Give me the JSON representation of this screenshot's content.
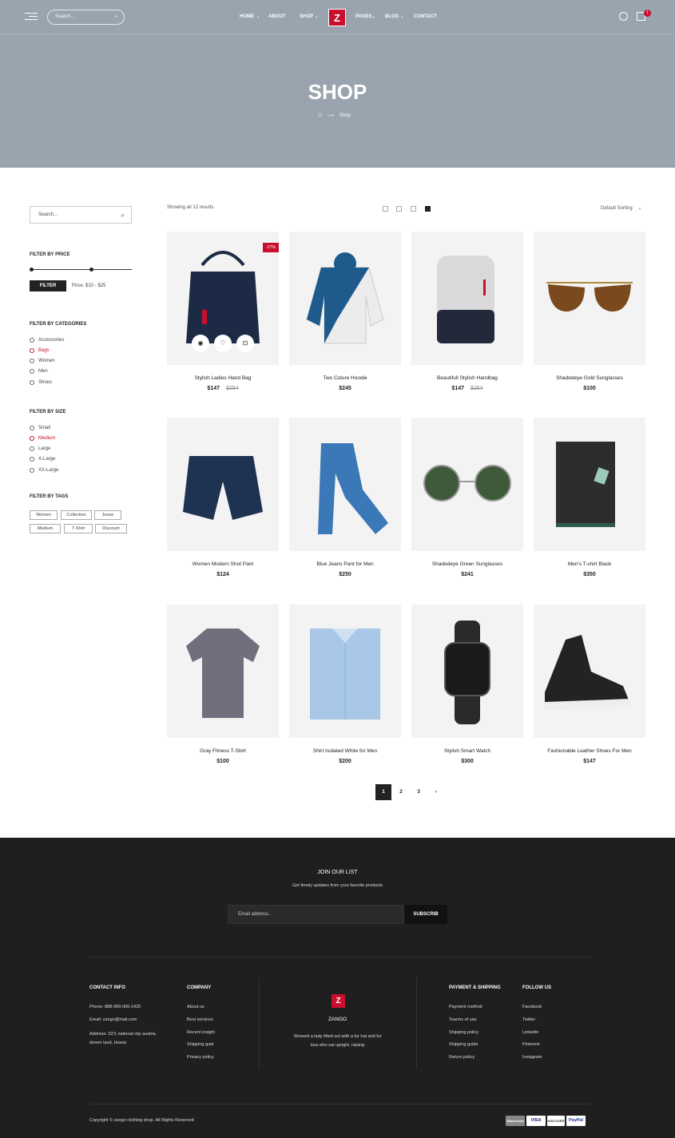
{
  "header": {
    "search_placeholder": "Search...",
    "menu": [
      {
        "label": "HOME",
        "dropdown": true
      },
      {
        "label": "ABOUT",
        "dropdown": false
      },
      {
        "label": "SHOP",
        "dropdown": true
      },
      {
        "label": "PAGES",
        "dropdown": true
      },
      {
        "label": "BLOG",
        "dropdown": true
      },
      {
        "label": "CONTACT",
        "dropdown": false
      }
    ],
    "logo": "Z",
    "cart_count": "1"
  },
  "hero": {
    "title": "SHOP",
    "breadcrumb_current": "Shop"
  },
  "sidebar": {
    "search_placeholder": "Search...",
    "price_heading": "FILTER BY PRICE",
    "filter_button": "FILTER",
    "price_label": "Price: $10 - $25",
    "categories_heading": "FILTER BY CATEGORIES",
    "categories": [
      "Accessories",
      "Bags",
      "Women",
      "Men",
      "Shoes"
    ],
    "active_category": "Bags",
    "size_heading": "FILTER BY SIZE",
    "sizes": [
      "Small",
      "Medium",
      "Large",
      "X-Large",
      "XX-Large"
    ],
    "active_size": "Medium",
    "tags_heading": "FILTER BY TAGS",
    "tags": [
      "Women",
      "Collection",
      "Jense",
      "Medium",
      "T-Shirt",
      "Discount"
    ]
  },
  "toolbar": {
    "results": "Showing all 12 results",
    "sorting": "Default Sorting"
  },
  "products": [
    {
      "name": "Stylish Ladies Hand Bag",
      "price": "$147",
      "old_price": "$254",
      "badge": "-27%",
      "icon": "handbag-icon"
    },
    {
      "name": "Two Colure Hoodie",
      "price": "$245",
      "icon": "hoodie-icon"
    },
    {
      "name": "Beautifull Stylish Handbag",
      "price": "$147",
      "old_price": "$254",
      "icon": "backpack-icon"
    },
    {
      "name": "Shadedeye Gold Sunglasses",
      "price": "$100",
      "icon": "sunglasses-icon"
    },
    {
      "name": "Women Modern Shot Pant",
      "price": "$124",
      "icon": "shorts-icon"
    },
    {
      "name": "Blue Jeans Pant for Men",
      "price": "$250",
      "icon": "jeans-icon"
    },
    {
      "name": "Shadedeye Green Sunglasses",
      "price": "$241",
      "icon": "round-sunglasses-icon"
    },
    {
      "name": "Men's T-shirt Black",
      "price": "$350",
      "icon": "folded-tshirt-icon"
    },
    {
      "name": "Gray Fitness T-Shirt",
      "price": "$100",
      "icon": "tshirt-icon"
    },
    {
      "name": "Shirt Isolated White for Men",
      "price": "$200",
      "icon": "shirt-icon"
    },
    {
      "name": "Stylish Smart Watch",
      "price": "$300",
      "icon": "smartwatch-icon"
    },
    {
      "name": "Fashionable Leather Shoes For Men",
      "price": "$147",
      "icon": "sneaker-icon"
    }
  ],
  "pagination": [
    "1",
    "2",
    "3"
  ],
  "newsletter": {
    "title": "JOIN OUR LIST",
    "subtitle": "Get timely updates from your favorite products",
    "placeholder": "Email address..",
    "button": "SUBSCRIB"
  },
  "footer": {
    "contact_heading": "CONTACT INFO",
    "phone": "Phone: 888-999-000-1425",
    "email": "Email: zango@mail.com",
    "address_line1": "Address: 22/1 natinoal city austria,",
    "address_line2": "dreem land, Huwai",
    "company_heading": "COMPANY",
    "company_links": [
      "About us",
      "Best services",
      "Recent insight",
      "Shipping guid",
      "Privacy policy"
    ],
    "brand_logo": "Z",
    "brand_name": "ZANGO",
    "brand_text_line1": "Showed a lady fitted out with a fur hat and fur",
    "brand_text_line2": "boa who sat upright, raising",
    "payment_heading": "PAYMENT & SHIPPING",
    "payment_links": [
      "Payment method",
      "Tearms of use",
      "Shipping policy",
      "Shipping guide",
      "Return policy"
    ],
    "follow_heading": "FOLLOW US",
    "follow_links": [
      "Facebook",
      "Twitter",
      "Linkedin",
      "Pinterest",
      "Instagram"
    ],
    "copyright": "Copyright © zango clothing shop. All Rights Reserved",
    "payments": [
      "Mastercard",
      "VISA",
      "DISCOVER",
      "PayPal"
    ]
  },
  "colors": {
    "accent": "#c8102e",
    "hero_bg": "#99a4ae",
    "footer_bg": "#1f1f1f"
  }
}
